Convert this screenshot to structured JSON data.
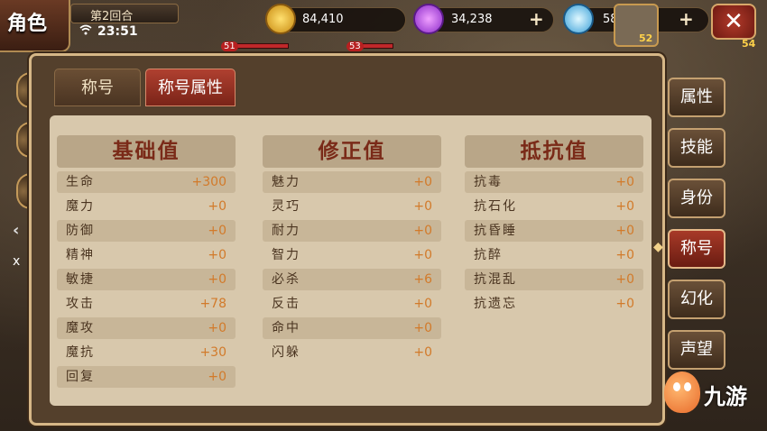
{
  "header": {
    "title": "角色",
    "round": "第2回合",
    "time": "23:51"
  },
  "resources": {
    "gold": "84,410",
    "purple_gem": "34,238",
    "diamond": "58"
  },
  "avatar": {
    "level": "52"
  },
  "hero_avatar": {
    "level": "54"
  },
  "hp_markers": [
    "51",
    "53"
  ],
  "tabs": [
    {
      "label": "称号"
    },
    {
      "label": "称号属性"
    }
  ],
  "columns": [
    {
      "header": "基础值",
      "rows": [
        {
          "label": "生命",
          "value": "+300"
        },
        {
          "label": "魔力",
          "value": "+0"
        },
        {
          "label": "防御",
          "value": "+0"
        },
        {
          "label": "精神",
          "value": "+0"
        },
        {
          "label": "敏捷",
          "value": "+0"
        },
        {
          "label": "攻击",
          "value": "+78"
        },
        {
          "label": "魔攻",
          "value": "+0"
        },
        {
          "label": "魔抗",
          "value": "+30"
        },
        {
          "label": "回复",
          "value": "+0"
        }
      ]
    },
    {
      "header": "修正值",
      "rows": [
        {
          "label": "魅力",
          "value": "+0"
        },
        {
          "label": "灵巧",
          "value": "+0"
        },
        {
          "label": "耐力",
          "value": "+0"
        },
        {
          "label": "智力",
          "value": "+0"
        },
        {
          "label": "必杀",
          "value": "+6"
        },
        {
          "label": "反击",
          "value": "+0"
        },
        {
          "label": "命中",
          "value": "+0"
        },
        {
          "label": "闪躲",
          "value": "+0"
        }
      ]
    },
    {
      "header": "抵抗值",
      "rows": [
        {
          "label": "抗毒",
          "value": "+0"
        },
        {
          "label": "抗石化",
          "value": "+0"
        },
        {
          "label": "抗昏睡",
          "value": "+0"
        },
        {
          "label": "抗醉",
          "value": "+0"
        },
        {
          "label": "抗混乱",
          "value": "+0"
        },
        {
          "label": "抗遗忘",
          "value": "+0"
        }
      ]
    }
  ],
  "side_tabs": [
    {
      "label": "属性"
    },
    {
      "label": "技能"
    },
    {
      "label": "身份"
    },
    {
      "label": "称号"
    },
    {
      "label": "幻化"
    },
    {
      "label": "声望"
    }
  ],
  "side_tab_active_index": 3,
  "watermark": "九游",
  "colors": {
    "value_orange": "#d27a2a",
    "header_red": "#7a2a18",
    "active_tab": "#a83a28"
  }
}
